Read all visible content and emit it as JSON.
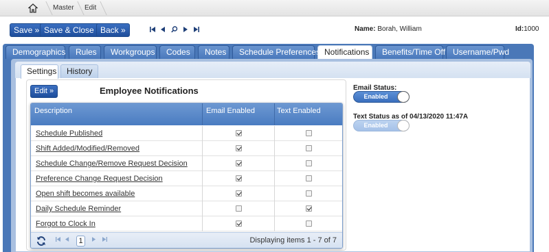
{
  "breadcrumb": {
    "home_icon": "home-icon",
    "items": [
      "Master",
      "Edit"
    ]
  },
  "toolbar": {
    "save_label": "Save »",
    "save_close_label": "Save & Close »",
    "back_label": "Back »",
    "name_label": "Name:",
    "name_value": "Borah, William",
    "id_label": "Id:",
    "id_value": "1000"
  },
  "tabs": [
    "Demographics",
    "Rules",
    "Workgroups",
    "Codes",
    "Notes",
    "Schedule Preferences",
    "Notifications",
    "Benefits/Time Off",
    "Username/Pwd"
  ],
  "active_tab": "Notifications",
  "subtabs": [
    "Settings",
    "History"
  ],
  "active_subtab": "Settings",
  "panel": {
    "edit_label": "Edit »",
    "title": "Employee Notifications"
  },
  "grid": {
    "columns": [
      "Description",
      "Email Enabled",
      "Text Enabled"
    ],
    "rows": [
      {
        "description": "Schedule Published",
        "email": true,
        "text": false
      },
      {
        "description": "Shift Added/Modified/Removed",
        "email": true,
        "text": false
      },
      {
        "description": "Schedule Change/Remove Request Decision",
        "email": true,
        "text": false
      },
      {
        "description": "Preference Change Request Decision",
        "email": true,
        "text": false
      },
      {
        "description": "Open shift becomes available",
        "email": true,
        "text": false
      },
      {
        "description": "Daily Schedule Reminder",
        "email": false,
        "text": true
      },
      {
        "description": "Forgot to Clock In",
        "email": true,
        "text": false
      }
    ],
    "pager": {
      "current_page": "1",
      "info": "Displaying items 1 - 7 of 7"
    }
  },
  "status": {
    "email_label": "Email Status:",
    "email_value": "Enabled",
    "text_label": "Text Status as of 04/13/2020 11:47A",
    "text_value": "Enabled"
  },
  "colors": {
    "accent": "#2f5ea8",
    "tab_blue": "#4a78b8"
  }
}
